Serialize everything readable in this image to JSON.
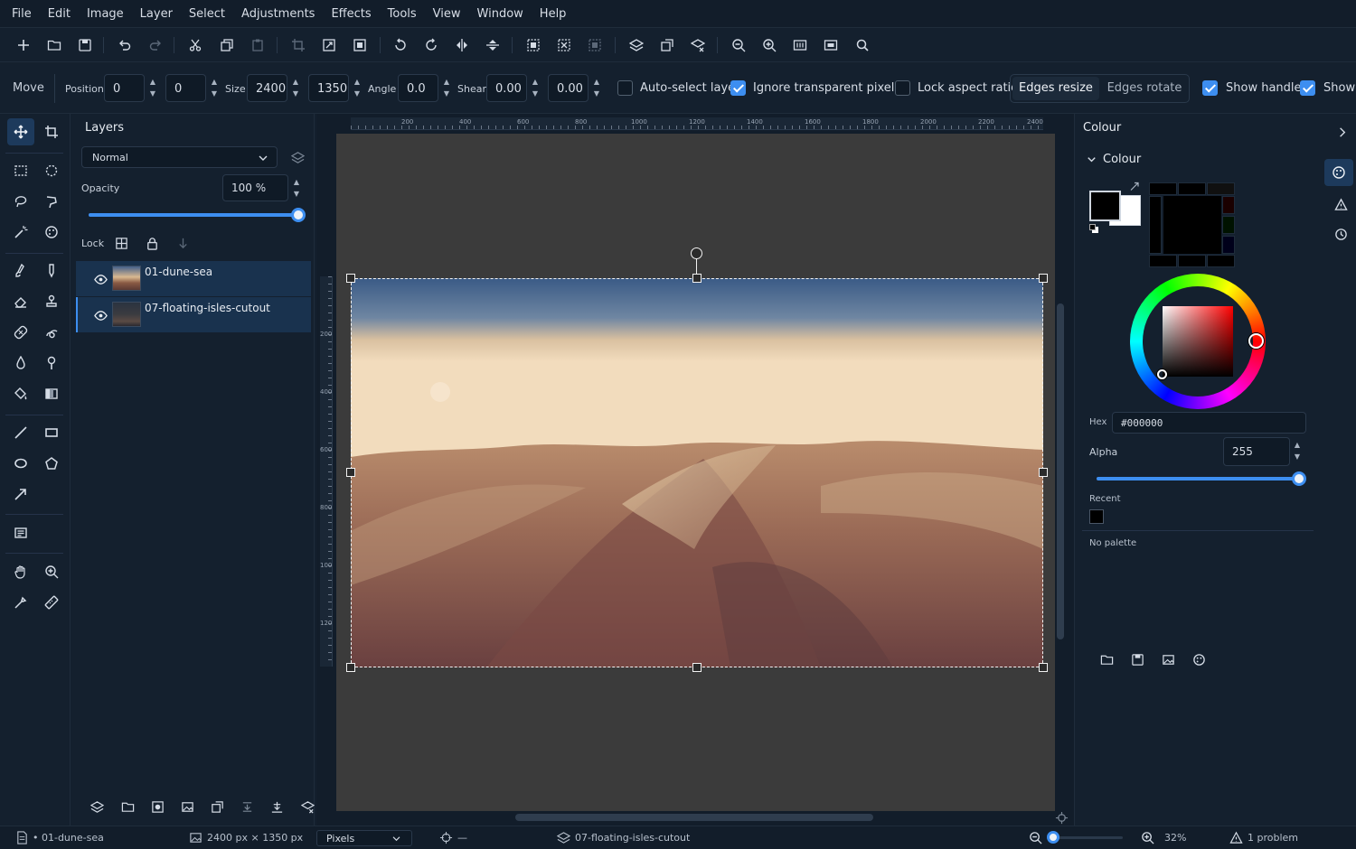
{
  "menubar": {
    "items": [
      "File",
      "Edit",
      "Image",
      "Layer",
      "Select",
      "Adjustments",
      "Effects",
      "Tools",
      "View",
      "Window",
      "Help"
    ]
  },
  "options": {
    "tool_name": "Move",
    "position_label": "Position",
    "position_x": "0",
    "position_y": "0",
    "size_label": "Size",
    "size_w": "2400",
    "size_h": "1350",
    "angle_label": "Angle",
    "angle": "0.0",
    "shear_label": "Shear",
    "shear_x": "0.00",
    "shear_y": "0.00",
    "auto_select": {
      "label": "Auto-select layer",
      "checked": false
    },
    "ignore_transparent": {
      "label": "Ignore transparent pixels",
      "checked": true
    },
    "lock_aspect": {
      "label": "Lock aspect ratio",
      "checked": false
    },
    "mode_tabs": [
      "Edges resize",
      "Edges rotate"
    ],
    "mode_selected": "Edges resize",
    "show_handles": {
      "label": "Show handles",
      "checked": true
    },
    "show_other": {
      "label": "Show",
      "checked": true
    }
  },
  "layers_panel": {
    "title": "Layers",
    "blend_mode": "Normal",
    "opacity_label": "Opacity",
    "opacity_value": "100 %",
    "opacity_fraction": 1.0,
    "lock_label": "Lock",
    "layers": [
      {
        "name": "01-dune-sea",
        "visible": true
      },
      {
        "name": "07-floating-isles-cutout",
        "visible": true
      }
    ]
  },
  "rulers": {
    "horizontal": [
      "200",
      "400",
      "600",
      "800",
      "1000",
      "1200",
      "1400",
      "1600",
      "1800",
      "2000",
      "2200",
      "2400"
    ],
    "vertical": [
      "200",
      "400",
      "600",
      "800",
      "1000",
      "1200"
    ]
  },
  "colour_panel": {
    "header": "Colour",
    "section": "Colour",
    "hex_label": "Hex",
    "hex_value": "#000000",
    "alpha_label": "Alpha",
    "alpha_value": "255",
    "alpha_fraction": 1.0,
    "recent_label": "Recent",
    "palette_text": "No palette",
    "primary_color": "#000000",
    "secondary_color": "#ffffff"
  },
  "status": {
    "document": "• 01-dune-sea",
    "dimensions": "2400 px × 1350 px",
    "unit": "Pixels",
    "cursor": "—",
    "active_layer": "07-floating-isles-cutout",
    "zoom": "32%",
    "problems": "1 problem"
  },
  "colors": {
    "accent": "#3d8ef0",
    "panel_bg": "#14202e",
    "selected_layer": "#19324e"
  }
}
